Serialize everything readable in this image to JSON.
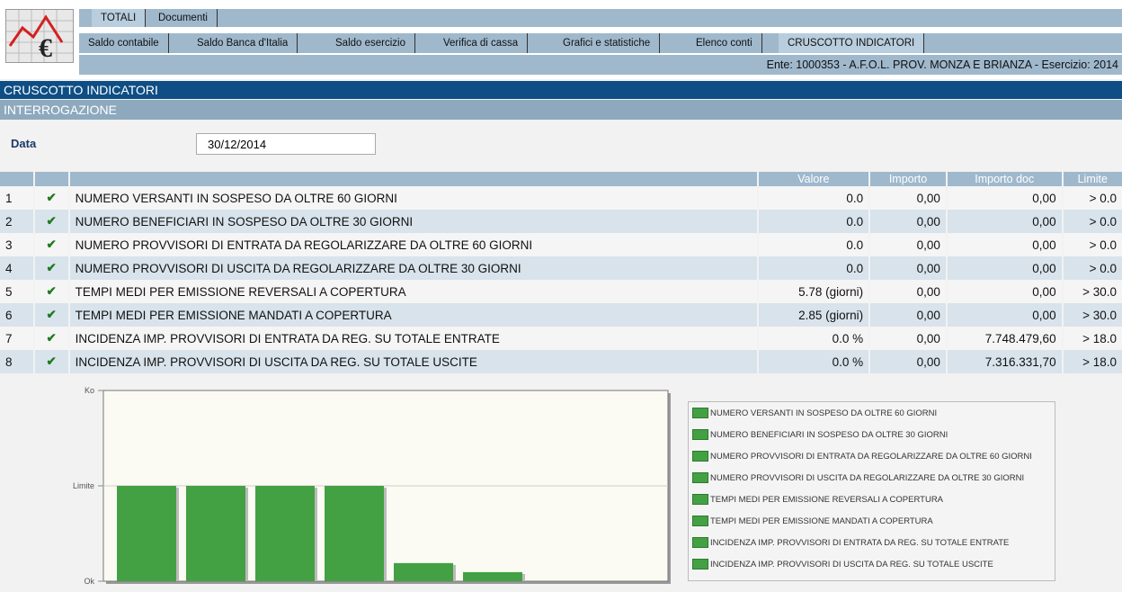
{
  "menu": {
    "level1": [
      "TOTALI",
      "Documenti"
    ],
    "level2": [
      "Saldo contabile",
      "Saldo Banca d'Italia",
      "Saldo esercizio",
      "Verifica di cassa",
      "Grafici e statistiche",
      "Elenco conti",
      "CRUSCOTTO INDICATORI"
    ],
    "ente": "Ente: 1000353 - A.F.O.L. PROV. MONZA E BRIANZA - Esercizio: 2014"
  },
  "headers": {
    "title": "CRUSCOTTO INDICATORI",
    "subtitle": "INTERROGAZIONE"
  },
  "form": {
    "data_label": "Data",
    "data_value": "30/12/2014"
  },
  "table": {
    "columns": [
      "",
      "",
      "",
      "Valore",
      "Importo",
      "Importo doc",
      "Limite"
    ],
    "rows": [
      {
        "n": "1",
        "desc": "NUMERO VERSANTI IN SOSPESO DA OLTRE 60 GIORNI",
        "valore": "0.0",
        "importo": "0,00",
        "importo_doc": "0,00",
        "limite": "> 0.0"
      },
      {
        "n": "2",
        "desc": "NUMERO BENEFICIARI IN SOSPESO DA OLTRE 30 GIORNI",
        "valore": "0.0",
        "importo": "0,00",
        "importo_doc": "0,00",
        "limite": "> 0.0"
      },
      {
        "n": "3",
        "desc": "NUMERO PROVVISORI DI ENTRATA DA REGOLARIZZARE DA OLTRE 60 GIORNI",
        "valore": "0.0",
        "importo": "0,00",
        "importo_doc": "0,00",
        "limite": "> 0.0"
      },
      {
        "n": "4",
        "desc": "NUMERO PROVVISORI DI USCITA DA REGOLARIZZARE DA OLTRE 30 GIORNI",
        "valore": "0.0",
        "importo": "0,00",
        "importo_doc": "0,00",
        "limite": "> 0.0"
      },
      {
        "n": "5",
        "desc": "TEMPI MEDI PER EMISSIONE REVERSALI A COPERTURA",
        "valore": "5.78 (giorni)",
        "importo": "0,00",
        "importo_doc": "0,00",
        "limite": "> 30.0"
      },
      {
        "n": "6",
        "desc": "TEMPI MEDI PER EMISSIONE MANDATI A COPERTURA",
        "valore": "2.85 (giorni)",
        "importo": "0,00",
        "importo_doc": "0,00",
        "limite": "> 30.0"
      },
      {
        "n": "7",
        "desc": "INCIDENZA IMP. PROVVISORI DI ENTRATA DA REG. SU TOTALE ENTRATE",
        "valore": "0.0 %",
        "importo": "0,00",
        "importo_doc": "7.748.479,60",
        "limite": "> 18.0"
      },
      {
        "n": "8",
        "desc": "INCIDENZA IMP. PROVVISORI DI USCITA DA REG. SU TOTALE USCITE",
        "valore": "0.0 %",
        "importo": "0,00",
        "importo_doc": "7.316.331,70",
        "limite": "> 18.0"
      }
    ]
  },
  "chart_data": {
    "type": "bar",
    "y_tick_labels": [
      "Ok",
      "Limite",
      "Ko"
    ],
    "ylim": [
      0,
      2
    ],
    "categories": [
      "NUMERO VERSANTI IN SOSPESO DA OLTRE 60 GIORNI",
      "NUMERO BENEFICIARI IN SOSPESO DA OLTRE 30 GIORNI",
      "NUMERO PROVVISORI DI ENTRATA DA REGOLARIZZARE DA OLTRE 60 GIORNI",
      "NUMERO PROVVISORI DI USCITA DA REGOLARIZZARE DA OLTRE 30 GIORNI",
      "TEMPI MEDI PER EMISSIONE REVERSALI A COPERTURA",
      "TEMPI MEDI PER EMISSIONE MANDATI A COPERTURA",
      "INCIDENZA IMP. PROVVISORI DI ENTRATA DA REG. SU TOTALE ENTRATE",
      "INCIDENZA IMP. PROVVISORI DI USCITA DA REG. SU TOTALE USCITE"
    ],
    "values": [
      1.0,
      1.0,
      1.0,
      1.0,
      0.19,
      0.095,
      0,
      0
    ],
    "bar_color": "#43a143",
    "legend_placement": "right",
    "grid": false
  }
}
